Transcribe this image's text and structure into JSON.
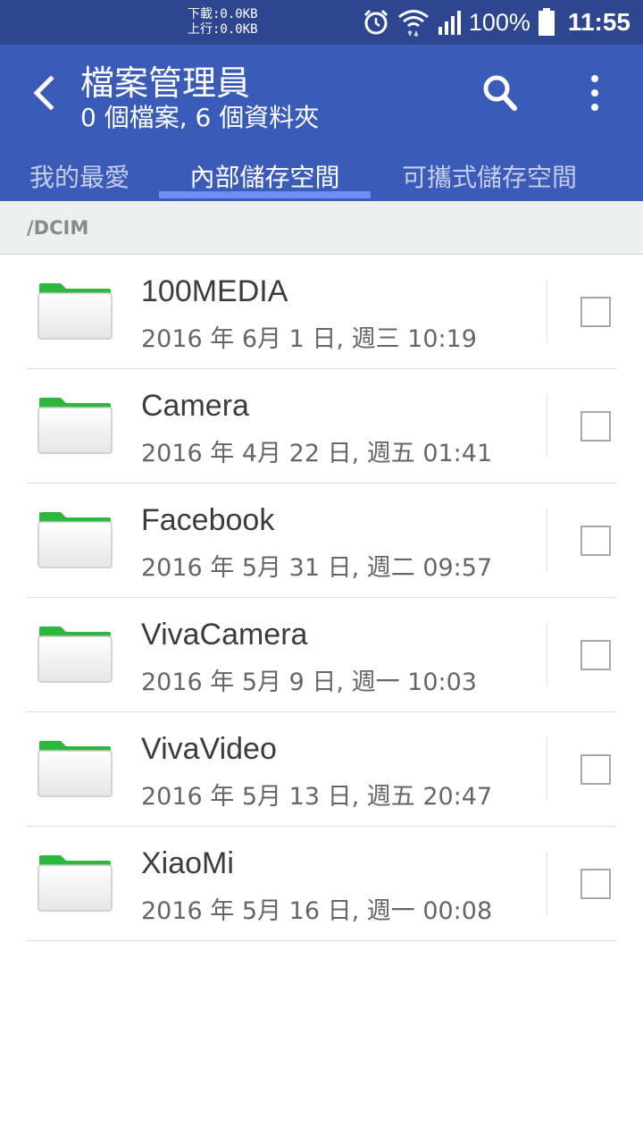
{
  "status_bar": {
    "download_speed": "下載:0.0KB",
    "upload_speed": "上行:0.0KB",
    "battery_percent": "100%",
    "time": "11:55",
    "icons": [
      "alarm-icon",
      "wifi-icon",
      "signal-icon",
      "battery-icon"
    ]
  },
  "app_bar": {
    "title": "檔案管理員",
    "subtitle": "0 個檔案, 6 個資料夾",
    "back_icon": "back-arrow-icon",
    "search_icon": "search-icon",
    "more_icon": "more-vert-icon",
    "background_color": "#3b5bb8"
  },
  "tabs": [
    {
      "label": "我的最愛",
      "active": false
    },
    {
      "label": "內部儲存空間",
      "active": true
    },
    {
      "label": "可攜式儲存空間",
      "active": false
    }
  ],
  "path": "/DCIM",
  "folders": [
    {
      "name": "100MEDIA",
      "date": "2016 年 6月 1 日, 週三 10:19",
      "checked": false
    },
    {
      "name": "Camera",
      "date": "2016 年 4月 22 日, 週五 01:41",
      "checked": false
    },
    {
      "name": "Facebook",
      "date": "2016 年 5月 31 日, 週二 09:57",
      "checked": false
    },
    {
      "name": "VivaCamera",
      "date": "2016 年 5月 9 日, 週一 10:03",
      "checked": false
    },
    {
      "name": "VivaVideo",
      "date": "2016 年 5月 13 日, 週五 20:47",
      "checked": false
    },
    {
      "name": "XiaoMi",
      "date": "2016 年 5月 16 日, 週一 00:08",
      "checked": false
    }
  ],
  "colors": {
    "status_bar": "#2e4590",
    "tab_indicator": "#6f8cf2",
    "folder_tab_green": "#2db83d"
  }
}
